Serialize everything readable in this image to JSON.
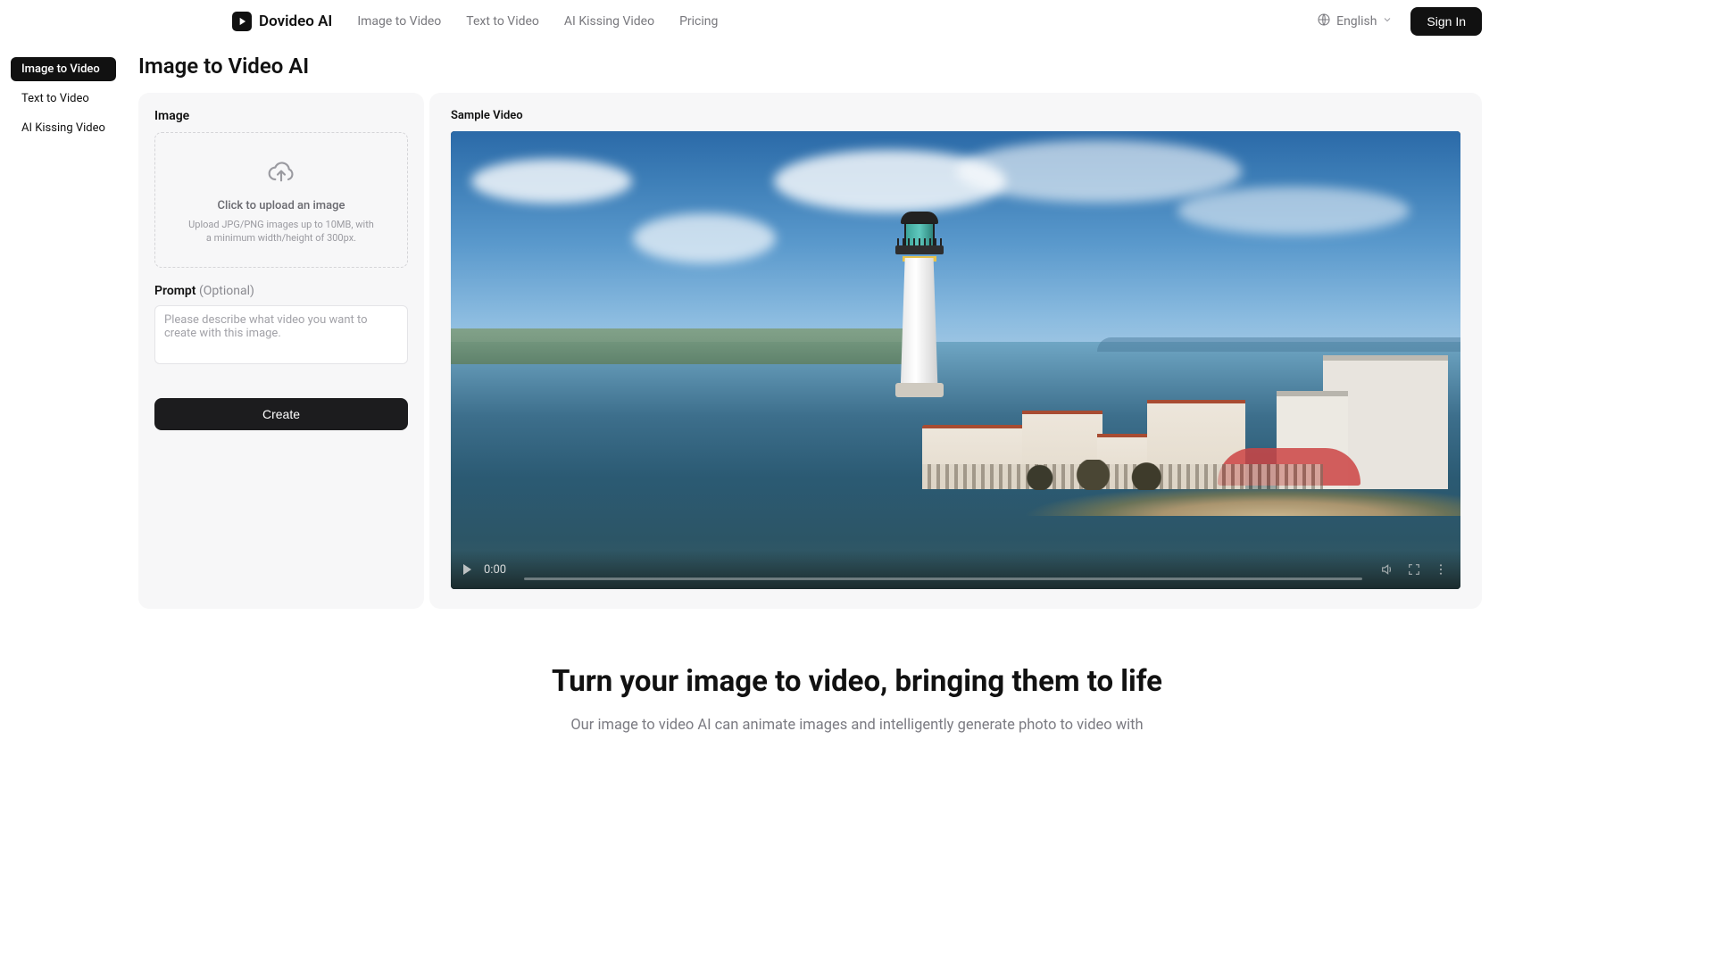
{
  "header": {
    "brand": "Dovideo AI",
    "nav": {
      "image_to_video": "Image to Video",
      "text_to_video": "Text to Video",
      "ai_kissing_video": "AI Kissing Video",
      "pricing": "Pricing"
    },
    "language": "English",
    "sign_in": "Sign In"
  },
  "sidebar": {
    "items": [
      {
        "label": "Image to Video",
        "active": true
      },
      {
        "label": "Text to Video",
        "active": false
      },
      {
        "label": "AI Kissing Video",
        "active": false
      }
    ]
  },
  "page": {
    "title": "Image to Video AI"
  },
  "form": {
    "image_label": "Image",
    "upload_title": "Click to upload an image",
    "upload_sub": "Upload JPG/PNG images up to 10MB, with a minimum width/height of 300px.",
    "prompt_label": "Prompt",
    "prompt_optional": "(Optional)",
    "prompt_placeholder": "Please describe what video you want to create with this image.",
    "create_button": "Create"
  },
  "sample": {
    "label": "Sample Video",
    "time": "0:00"
  },
  "hero": {
    "title": "Turn your image to video, bringing them to life",
    "sub": "Our image to video AI can animate images and intelligently generate photo to video with"
  }
}
